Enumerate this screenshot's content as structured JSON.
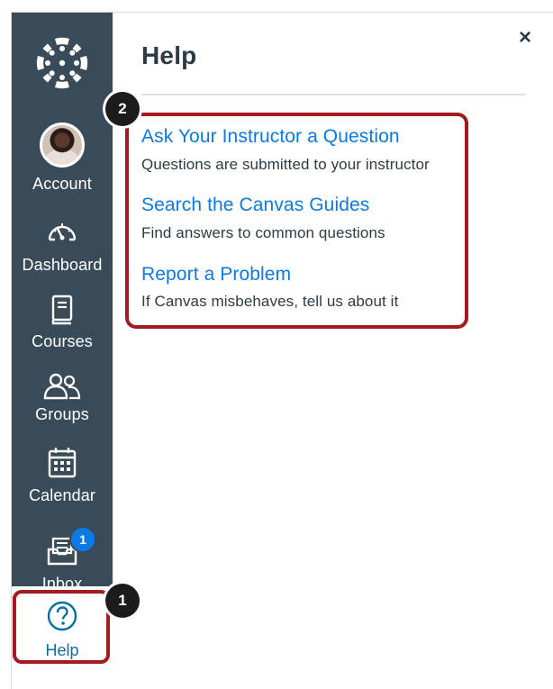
{
  "nav": {
    "logo_icon": "canvas-logo-icon",
    "items": [
      {
        "key": "account",
        "label": "Account",
        "icon": "avatar"
      },
      {
        "key": "dashboard",
        "label": "Dashboard",
        "icon": "speedometer-icon"
      },
      {
        "key": "courses",
        "label": "Courses",
        "icon": "book-icon"
      },
      {
        "key": "groups",
        "label": "Groups",
        "icon": "users-icon"
      },
      {
        "key": "calendar",
        "label": "Calendar",
        "icon": "calendar-icon"
      },
      {
        "key": "inbox",
        "label": "Inbox",
        "icon": "inbox-icon",
        "badge": "1"
      },
      {
        "key": "help",
        "label": "Help",
        "icon": "question-circle-icon",
        "active": true
      }
    ]
  },
  "tray": {
    "title": "Help",
    "close_label": "×",
    "links": [
      {
        "title": "Ask Your Instructor a Question",
        "description": "Questions are submitted to your instructor"
      },
      {
        "title": "Search the Canvas Guides",
        "description": "Find answers to common questions"
      },
      {
        "title": "Report a Problem",
        "description": "If Canvas misbehaves, tell us about it"
      }
    ]
  },
  "callouts": [
    "1",
    "2"
  ],
  "colors": {
    "nav_bg": "#394b58",
    "link": "#0b7ae5",
    "active_text": "#0770a3",
    "highlight": "#a41b1f",
    "badge": "#0b7ae5"
  }
}
